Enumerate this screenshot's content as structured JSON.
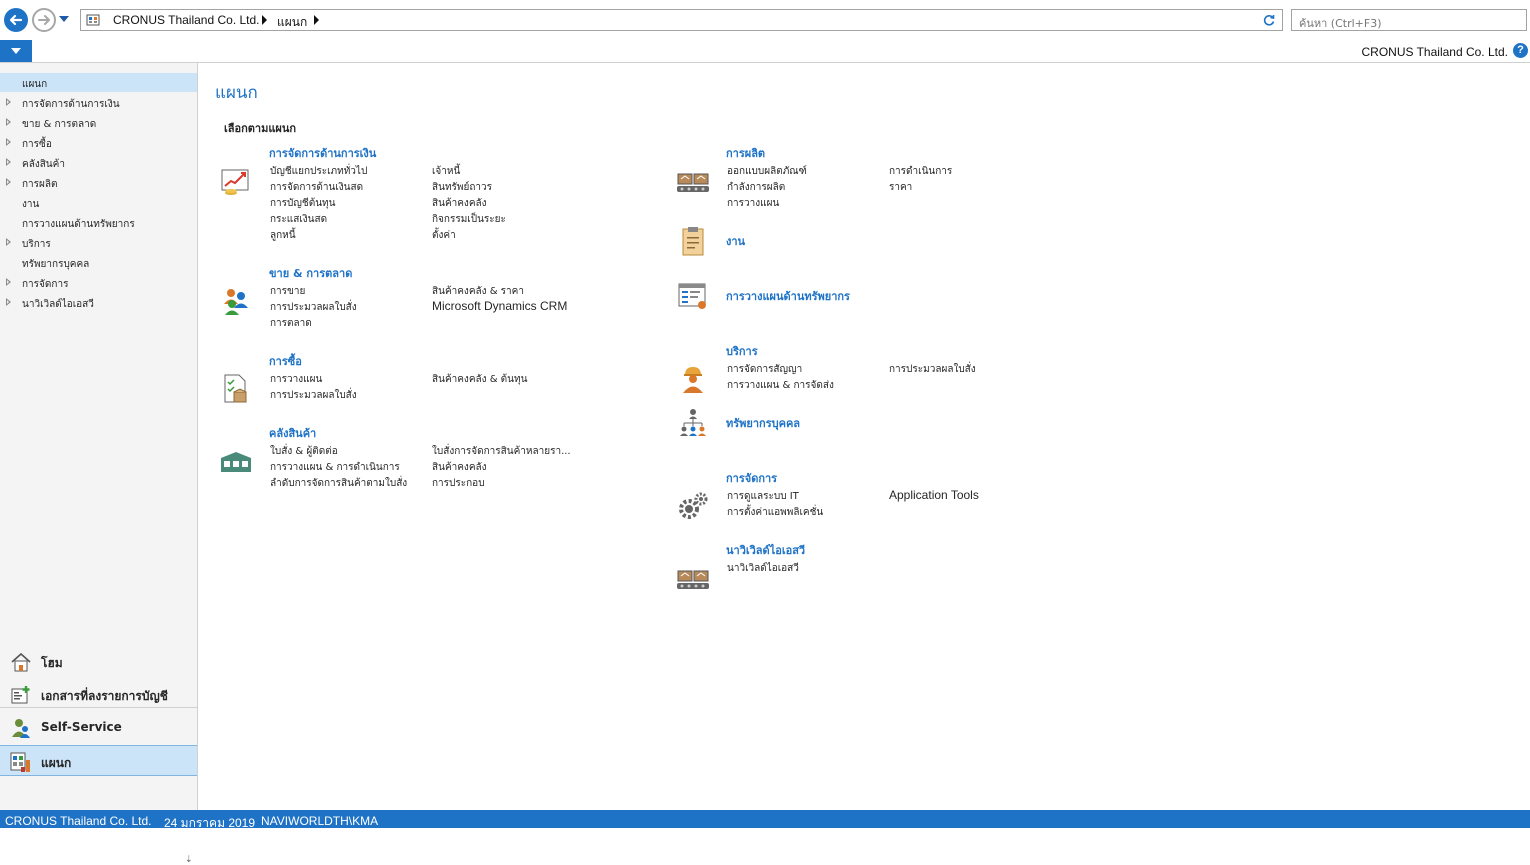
{
  "topbar": {
    "breadcrumb": [
      "CRONUS Thailand Co. Ltd.",
      "แผนก"
    ],
    "search_placeholder": "ค้นหา (Ctrl+F3)",
    "company": "CRONUS Thailand Co. Ltd.",
    "help_label": "?"
  },
  "leftnav": {
    "tree": [
      {
        "label": "แผนก",
        "expandable": false,
        "selected": true
      },
      {
        "label": "การจัดการด้านการเงิน",
        "expandable": true
      },
      {
        "label": "ขาย & การตลาด",
        "expandable": true
      },
      {
        "label": "การซื้อ",
        "expandable": true
      },
      {
        "label": "คลังสินค้า",
        "expandable": true
      },
      {
        "label": "การผลิต",
        "expandable": true
      },
      {
        "label": "งาน",
        "expandable": false
      },
      {
        "label": "การวางแผนด้านทรัพยากร",
        "expandable": false
      },
      {
        "label": "บริการ",
        "expandable": true
      },
      {
        "label": "ทรัพยากรบุคคล",
        "expandable": false
      },
      {
        "label": "การจัดการ",
        "expandable": true
      },
      {
        "label": "นาวิเวิลด์ไอเอสวี",
        "expandable": true
      }
    ],
    "bottom_buttons": [
      {
        "label": "โฮม",
        "icon": "home-icon"
      },
      {
        "label": "เอกสารที่ลงรายการบัญชี",
        "icon": "posted-documents-icon"
      },
      {
        "label": "Self-Service",
        "icon": "self-service-icon"
      },
      {
        "label": "แผนก",
        "icon": "departments-icon",
        "selected": true
      }
    ],
    "more_glyph": "⇣"
  },
  "content": {
    "title": "แผนก",
    "section_heading": "เลือกตามแผนก",
    "left_groups": [
      {
        "title": "การจัดการด้านการเงิน",
        "icon": "finance-chart-icon",
        "col1": [
          "บัญชีแยกประเภททั่วไป",
          "การจัดการด้านเงินสด",
          "การบัญชีต้นทุน",
          "กระแสเงินสด",
          "ลูกหนี้"
        ],
        "col2": [
          "เจ้าหนี้",
          "สินทรัพย์ถาวร",
          "สินค้าคงคลัง",
          "กิจกรรมเป็นระยะ",
          "ตั้งค่า"
        ]
      },
      {
        "title": "ขาย & การตลาด",
        "icon": "sales-people-icon",
        "col1": [
          "การขาย",
          "การประมวลผลใบสั่ง",
          "การตลาด"
        ],
        "col2": [
          "สินค้าคงคลัง & ราคา",
          "Microsoft Dynamics CRM"
        ]
      },
      {
        "title": "การซื้อ",
        "icon": "purchase-document-icon",
        "col1": [
          "การวางแผน",
          "การประมวลผลใบสั่ง"
        ],
        "col2": [
          "สินค้าคงคลัง & ต้นทุน"
        ]
      },
      {
        "title": "คลังสินค้า",
        "icon": "warehouse-icon",
        "col1": [
          "ใบสั่ง & ผู้ติดต่อ",
          "การวางแผน & การดำเนินการ",
          "ลำดับการจัดการสินค้าตามใบสั่ง"
        ],
        "col2": [
          "ใบสั่งการจัดการสินค้าหลายรา...",
          "สินค้าคงคลัง",
          "การประกอบ"
        ]
      }
    ],
    "right_groups": [
      {
        "title": "การผลิต",
        "icon": "manufacturing-icon",
        "col1": [
          "ออกแบบผลิตภัณฑ์",
          "กำลังการผลิต",
          "การวางแผน"
        ],
        "col2": [
          "การดำเนินการ",
          "ราคา"
        ]
      },
      {
        "title": "งาน",
        "icon": "clipboard-icon",
        "col1": [],
        "col2": []
      },
      {
        "title": "การวางแผนด้านทรัพยากร",
        "icon": "resource-planning-icon",
        "col1": [],
        "col2": []
      },
      {
        "title": "บริการ",
        "icon": "service-worker-icon",
        "col1": [
          "การจัดการสัญญา",
          "การวางแผน & การจัดส่ง"
        ],
        "col2": [
          "การประมวลผลใบสั่ง"
        ]
      },
      {
        "title": "ทรัพยากรบุคคล",
        "icon": "org-chart-icon",
        "col1": [],
        "col2": []
      },
      {
        "title": "การจัดการ",
        "icon": "gears-icon",
        "col1": [
          "การดูแลระบบ IT",
          "การตั้งค่าแอพพลิเคชั่น"
        ],
        "col2": [
          "Application Tools"
        ]
      },
      {
        "title": "นาวิเวิลด์ไอเอสวี",
        "icon": "manufacturing-icon",
        "col1": [
          "นาวิเวิลด์ไอเอสวี"
        ],
        "col2": []
      }
    ]
  },
  "statusbar": {
    "company": "CRONUS Thailand Co. Ltd.",
    "date": "24 มกราคม 2019",
    "user": "NAVIWORLDTH\\KMA"
  },
  "colors": {
    "accent": "#1f73c6",
    "nav_selected": "#cce4f7",
    "nav_bg": "#f4f4f4"
  }
}
